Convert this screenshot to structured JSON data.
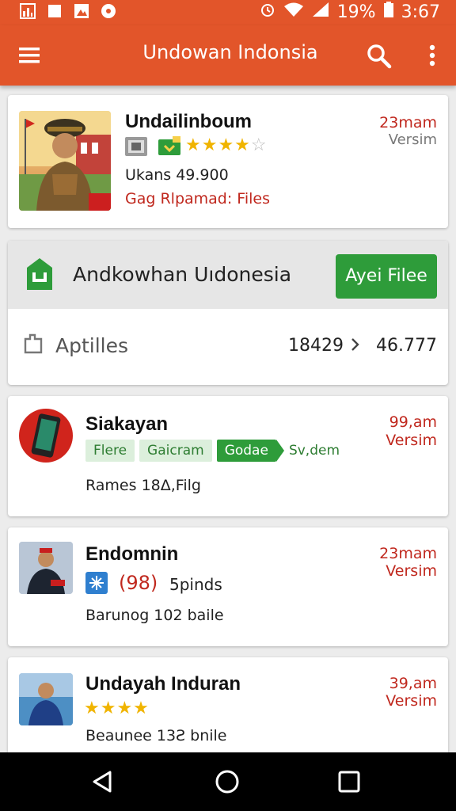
{
  "status_bar": {
    "battery": "19%",
    "time": "3:67",
    "left_icons": [
      "chart-icon",
      "square-icon",
      "photo-icon",
      "record-icon"
    ],
    "right_icons": [
      "alarm-icon",
      "wifi-icon",
      "signal-icon",
      "battery-icon"
    ]
  },
  "app_bar": {
    "title": "Undowan Indonsia",
    "icons": [
      "menu-icon",
      "search-icon",
      "more-vert-icon"
    ]
  },
  "colors": {
    "brand": "#e2552a",
    "accent_green": "#2e9c3a",
    "size_red": "#c0281e"
  },
  "items": [
    {
      "name": "Undailinboum",
      "size": "23mam",
      "version": "Versim",
      "rating": 3.5,
      "line1": "Ukans 49.900",
      "line2": "Gag Rlpamad: Files"
    }
  ],
  "featured": {
    "title": "Andkowhan Uıdonesia",
    "button": "Ayei Filee",
    "row_label": "Aptilles",
    "count_left": "18429",
    "count_right": "46.777"
  },
  "apps": [
    {
      "name": "Siakayan",
      "size": "99,am",
      "version": "Versim",
      "tags": [
        "Flere",
        "Gaicram",
        "Godae"
      ],
      "tag_extra": "Sv,dem",
      "detail": "Rames 18Δ,Filg"
    },
    {
      "name": "Endomnin",
      "size": "23mam",
      "version": "Versim",
      "rating_text": "(98)",
      "rating_suffix": "5pinds",
      "detail": "Barunog 102 baile"
    },
    {
      "name": "Undayah Induran",
      "size": "39,am",
      "version": "Versim",
      "rating": 4,
      "detail": "Beaunee 13Ƨ bnile"
    }
  ]
}
